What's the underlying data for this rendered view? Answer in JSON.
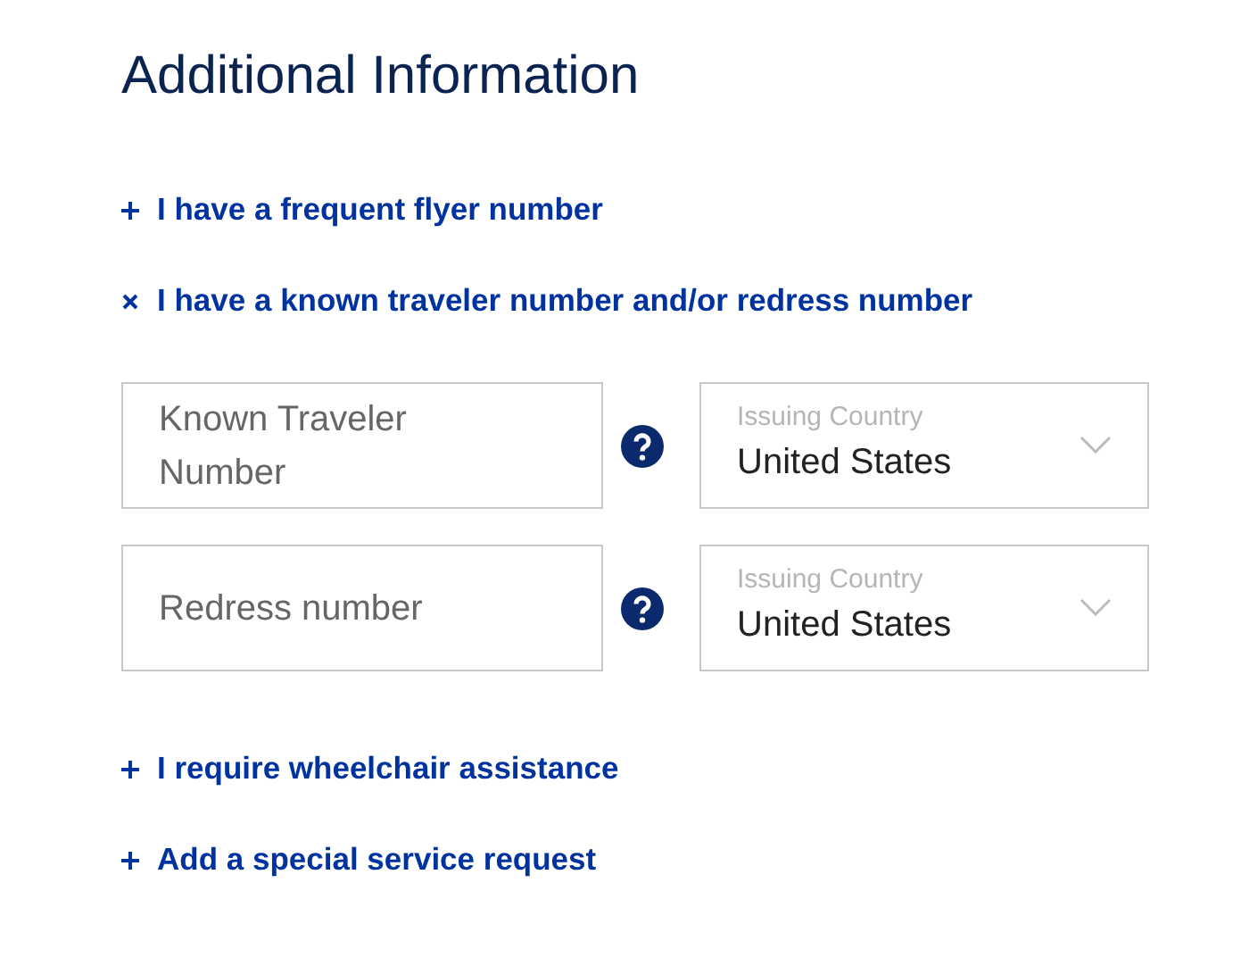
{
  "heading": "Additional Information",
  "toggles_top": [
    {
      "label": "I have a frequent flyer number",
      "expanded": false
    },
    {
      "label": "I have a known traveler number and/or redress number",
      "expanded": true
    }
  ],
  "field_rows": [
    {
      "input": {
        "placeholder": "Known Traveler Number"
      },
      "select": {
        "label": "Issuing Country",
        "value": "United States"
      }
    },
    {
      "input": {
        "placeholder": "Redress number"
      },
      "select": {
        "label": "Issuing Country",
        "value": "United States"
      }
    }
  ],
  "toggles_bottom": [
    {
      "label": "I require wheelchair assistance",
      "expanded": false
    },
    {
      "label": "Add a special service request",
      "expanded": false
    }
  ]
}
